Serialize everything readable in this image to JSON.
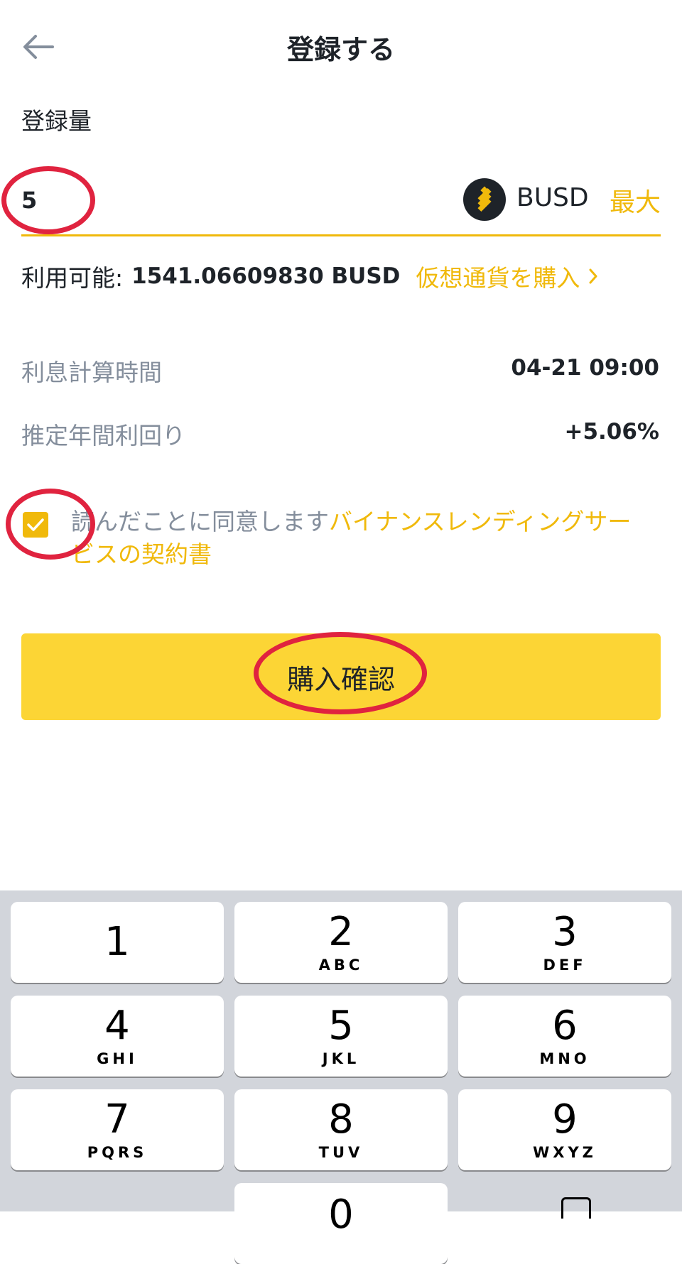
{
  "header": {
    "title": "登録する"
  },
  "form": {
    "amount_label": "登録量",
    "amount_value": "5",
    "coin": "BUSD",
    "max_label": "最大",
    "available_label": "利用可能:",
    "available_value": "1541.06609830 BUSD",
    "buy_link": "仮想通貨を購入"
  },
  "info": {
    "interest_time_label": "利息計算時間",
    "interest_time_value": "04-21 09:00",
    "apy_label": "推定年間利回り",
    "apy_value": "+5.06%"
  },
  "agreement": {
    "checked": true,
    "text": "読んだことに同意します",
    "link": "バイナンスレンディングサービスの契約書"
  },
  "confirm": {
    "label": "購入確認"
  },
  "keypad": {
    "keys": [
      {
        "digit": "1",
        "letters": ""
      },
      {
        "digit": "2",
        "letters": "ABC"
      },
      {
        "digit": "3",
        "letters": "DEF"
      },
      {
        "digit": "4",
        "letters": "GHI"
      },
      {
        "digit": "5",
        "letters": "JKL"
      },
      {
        "digit": "6",
        "letters": "MNO"
      },
      {
        "digit": "7",
        "letters": "PQRS"
      },
      {
        "digit": "8",
        "letters": "TUV"
      },
      {
        "digit": "9",
        "letters": "WXYZ"
      },
      {
        "digit": "0",
        "letters": ""
      }
    ]
  },
  "colors": {
    "accent": "#f0b90b",
    "button": "#fcd535",
    "annotation": "#e0233f",
    "keypad_bg": "#d2d5db"
  }
}
